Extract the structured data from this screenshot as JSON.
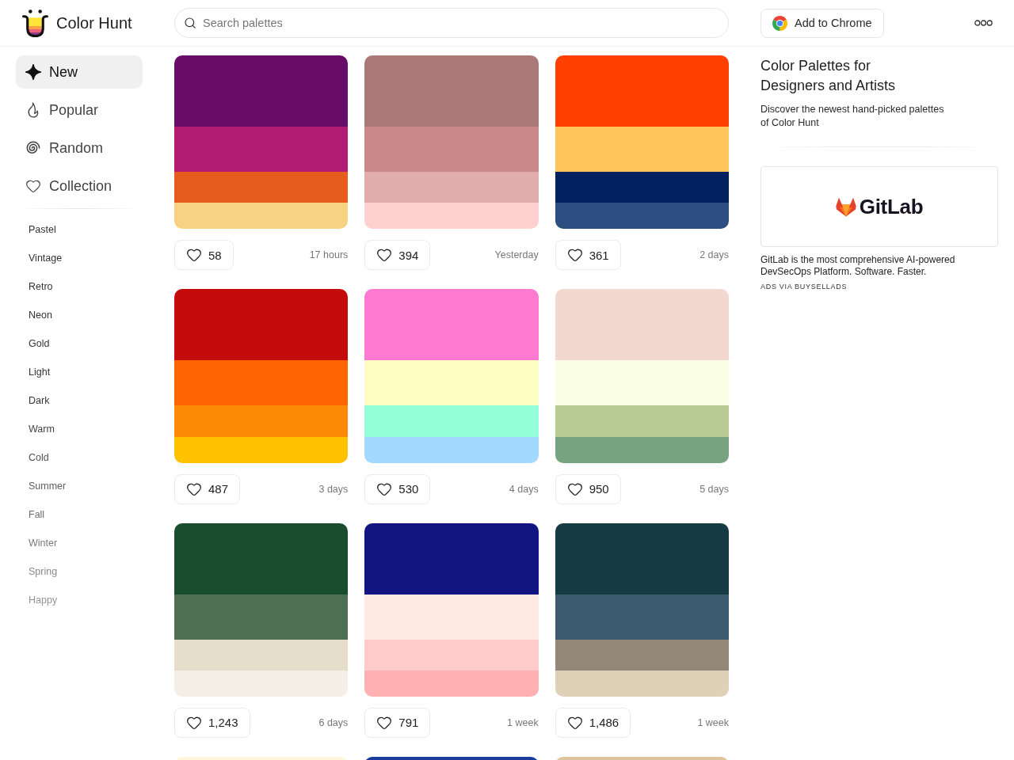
{
  "header": {
    "brand": "Color Hunt",
    "search": {
      "placeholder": "Search palettes"
    },
    "extension_button": "Add to Chrome"
  },
  "sidebar": {
    "nav": [
      {
        "label": "New",
        "selected": true
      },
      {
        "label": "Popular",
        "selected": false
      },
      {
        "label": "Random",
        "selected": false
      },
      {
        "label": "Collection",
        "selected": false
      }
    ],
    "tags": [
      "Pastel",
      "Vintage",
      "Retro",
      "Neon",
      "Gold",
      "Light",
      "Dark",
      "Warm",
      "Cold",
      "Summer",
      "Fall",
      "Winter",
      "Spring",
      "Happy"
    ]
  },
  "palettes": [
    {
      "colors": [
        {
          "color": "#670D68"
        },
        {
          "color": "#B31B72"
        },
        {
          "color": "#E55C1D"
        },
        {
          "color": "#F7D282"
        }
      ],
      "likes": "58",
      "time": "17 hours"
    },
    {
      "colors": [
        {
          "color": "#A97A77"
        },
        {
          "color": "#CB8888"
        },
        {
          "color": "#E0ADAC"
        },
        {
          "color": "#FFD0D0"
        }
      ],
      "likes": "394",
      "time": "Yesterday"
    },
    {
      "colors": [
        {
          "color": "#FF4000"
        },
        {
          "color": "#FFC55A"
        },
        {
          "color": "#00215E"
        },
        {
          "color": "#2C4E80"
        }
      ],
      "likes": "361",
      "time": "2 days"
    },
    {
      "colors": [
        {
          "color": "#C40C0C"
        },
        {
          "color": "#FF6500"
        },
        {
          "color": "#FF8A08"
        },
        {
          "color": "#FFC100"
        }
      ],
      "likes": "487",
      "time": "3 days"
    },
    {
      "colors": [
        {
          "color": "#FF7BD2"
        },
        {
          "color": "#FDFDC4"
        },
        {
          "color": "#94FFD8"
        },
        {
          "color": "#A3D8FF"
        }
      ],
      "likes": "530",
      "time": "4 days"
    },
    {
      "colors": [
        {
          "color": "#F3D8CF"
        },
        {
          "color": "#FAFFE4"
        },
        {
          "color": "#B8CC94"
        },
        {
          "color": "#77A380"
        }
      ],
      "likes": "950",
      "time": "5 days"
    },
    {
      "colors": [
        {
          "color": "#1A4D2E"
        },
        {
          "color": "#4F6F52"
        },
        {
          "color": "#E6DECA"
        },
        {
          "color": "#F5EEE6"
        }
      ],
      "likes": "1,243",
      "time": "6 days"
    },
    {
      "colors": [
        {
          "color": "#121481"
        },
        {
          "color": "#FFEAE3"
        },
        {
          "color": "#FFCBCB"
        },
        {
          "color": "#FFB1B1"
        }
      ],
      "likes": "791",
      "time": "1 week"
    },
    {
      "colors": [
        {
          "color": "#173B45"
        },
        {
          "color": "#3D5B6F"
        },
        {
          "color": "#948979"
        },
        {
          "color": "#DFD0B8"
        }
      ],
      "likes": "1,486",
      "time": "1 week"
    },
    {
      "colors": [
        {
          "color": "#FFF7DB"
        }
      ]
    },
    {
      "colors": [
        {
          "color": "#1A3D9D"
        }
      ]
    },
    {
      "colors": [
        {
          "color": "#DFC39E"
        }
      ]
    }
  ],
  "intro": {
    "title": "Color Palettes for Designers and Artists",
    "description": "Discover the newest hand-picked palettes of Color Hunt"
  },
  "ad": {
    "brand": "GitLab",
    "text": "GitLab is the most comprehensive AI-powered DevSecOps Platform. Software. Faster.",
    "label": "ADS VIA BUYSELLADS"
  }
}
